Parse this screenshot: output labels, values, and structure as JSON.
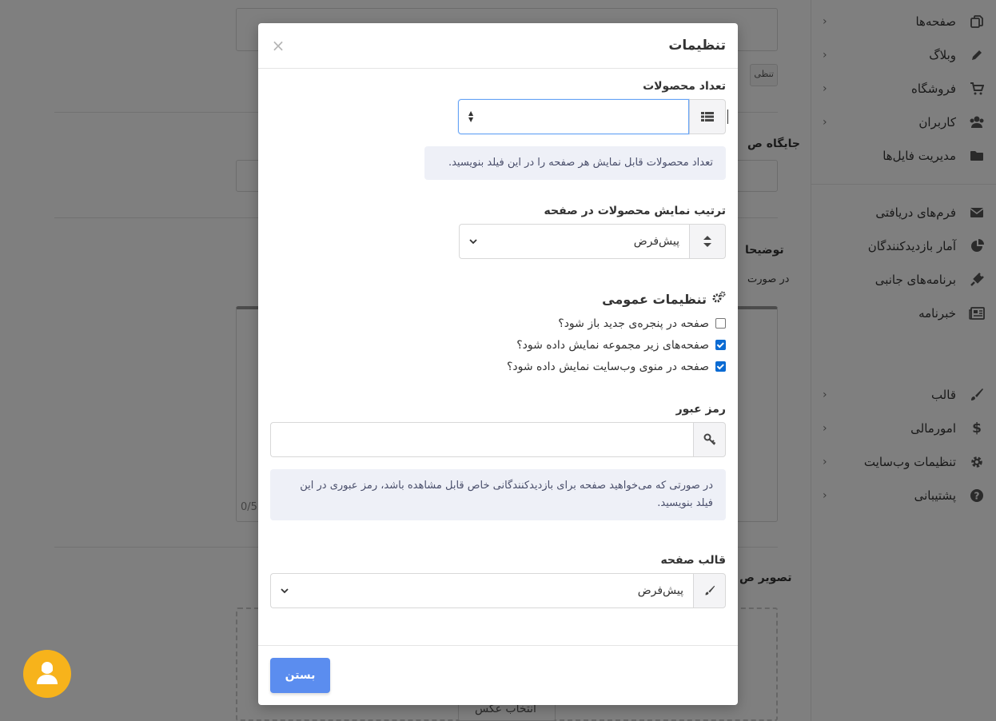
{
  "sidebar": {
    "items": [
      {
        "label": "صفحه‌ها",
        "icon": "copy-icon",
        "chevron": true
      },
      {
        "label": "وبلاگ",
        "icon": "pencil-icon",
        "chevron": true
      },
      {
        "label": "فروشگاه",
        "icon": "cart-icon",
        "chevron": true
      },
      {
        "label": "کاربران",
        "icon": "users-icon",
        "chevron": true
      },
      {
        "label": "مدیریت فایل‌ها",
        "icon": "folder-icon",
        "chevron": false
      }
    ],
    "items2": [
      {
        "label": "فرم‌های دریافتی",
        "icon": "envelope-icon"
      },
      {
        "label": "آمار بازدیدکنندگان",
        "icon": "pie-chart-icon"
      },
      {
        "label": "برنامه‌های جانبی",
        "icon": "plug-icon"
      },
      {
        "label": "خبرنامه",
        "icon": "newspaper-icon"
      }
    ],
    "items3": [
      {
        "label": "قالب",
        "icon": "brush-icon"
      },
      {
        "label": "امورمالی",
        "icon": "dollar-icon"
      },
      {
        "label": "تنظیمات وب‌سایت",
        "icon": "gear-icon"
      },
      {
        "label": "پشتیبانی",
        "icon": "question-icon"
      }
    ]
  },
  "background": {
    "settings_btn": "تنظی",
    "jaygah_label": "جایگاه ص",
    "tozihat_label": "توضیحا",
    "dar_surat": "در صورت",
    "char_count": "0/5",
    "tasvir_label": "تصویر ص",
    "choose_image": "انتخاب عکس"
  },
  "modal": {
    "title": "تنظیمات",
    "close": "×",
    "product_count": {
      "label": "تعداد محصولات",
      "value": "",
      "help": "تعداد محصولات قابل نمایش هر صفحه را در این فیلد بنویسید."
    },
    "sort_order": {
      "label": "ترتیب نمایش محصولات در صفحه",
      "selected": "پیش‌فرض"
    },
    "general": {
      "title": "تنظیمات عمومی",
      "options": [
        {
          "label": "صفحه در پنجره‌ی جدید باز شود؟",
          "checked": false
        },
        {
          "label": "صفحه‌های زیر مجموعه نمایش داده شود؟",
          "checked": true
        },
        {
          "label": "صفحه در منوی وب‌سایت نمایش داده شود؟",
          "checked": true
        }
      ]
    },
    "password": {
      "label": "رمز عبور",
      "value": "",
      "help": "در صورتی که می‌خواهید صفحه برای بازدیدکنندگانی خاص قابل مشاهده باشد، رمز عبوری در این فیلد بنویسید."
    },
    "template": {
      "label": "قالب صفحه",
      "selected": "پیش‌فرض"
    },
    "close_button": "بستن"
  },
  "colors": {
    "primary": "#5b8def",
    "chat": "#f7b31b",
    "checkbox": "#0b6bd3",
    "help_bg": "#eef0f7"
  }
}
